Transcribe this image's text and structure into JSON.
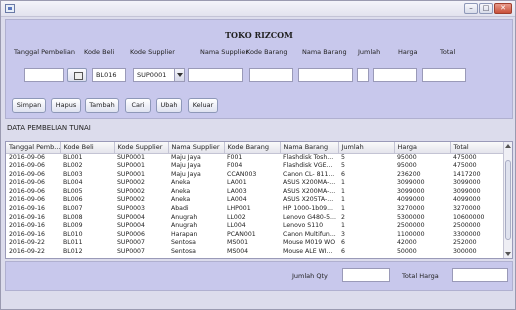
{
  "window": {
    "title": ""
  },
  "form": {
    "title": "TOKO RIZCOM",
    "labels": {
      "tanggal": "Tanggal Pembelian",
      "kode_beli": "Kode Beli",
      "kode_supplier": "Kode Supplier",
      "nama_supplier": "Nama Supplier",
      "kode_barang": "Kode Barang",
      "nama_barang": "Nama Barang",
      "jumlah": "Jumlah",
      "harga": "Harga",
      "total": "Total"
    },
    "values": {
      "tanggal": "",
      "kode_beli": "BL016",
      "kode_supplier": "SUP0001",
      "nama_supplier": "",
      "kode_barang": "",
      "nama_barang": "",
      "jumlah": "",
      "harga": "",
      "total": ""
    },
    "buttons": {
      "simpan": "Simpan",
      "hapus": "Hapus",
      "tambah": "Tambah",
      "cari": "Cari",
      "ubah": "Ubah",
      "keluar": "Keluar"
    }
  },
  "table": {
    "section_label": "DATA PEMBELIAN TUNAI",
    "columns": [
      "Tanggal Pemb...",
      "Kode Beli",
      "Kode Supplier",
      "Nama Supplier",
      "Kode Barang",
      "Nama Barang",
      "Jumlah",
      "Harga",
      "Total"
    ],
    "rows": [
      [
        "2016-09-06",
        "BL001",
        "SUP0001",
        "Maju Jaya",
        "F001",
        "Flashdisk Tosh...",
        "5",
        "95000",
        "475000"
      ],
      [
        "2016-09-06",
        "BL002",
        "SUP0001",
        "Maju Jaya",
        "F004",
        "Flashdisk VGE...",
        "5",
        "95000",
        "475000"
      ],
      [
        "2016-09-06",
        "BL003",
        "SUP0001",
        "Maju Jaya",
        "CCAN003",
        "Canon CL- 811...",
        "6",
        "236200",
        "1417200"
      ],
      [
        "2016-09-06",
        "BL004",
        "SUP0002",
        "Aneka",
        "LA001",
        "ASUS X200MA-...",
        "1",
        "3099000",
        "3099000"
      ],
      [
        "2016-09-06",
        "BL005",
        "SUP0002",
        "Aneka",
        "LA003",
        "ASUS X200MA-...",
        "1",
        "3099000",
        "3099000"
      ],
      [
        "2016-09-06",
        "BL006",
        "SUP0002",
        "Aneka",
        "LA004",
        "ASUS X205TA-...",
        "1",
        "4099000",
        "4099000"
      ],
      [
        "2016-09-16",
        "BL007",
        "SUP0003",
        "Abadi",
        "LHP001",
        "HP 1000-1b09...",
        "1",
        "3270000",
        "3270000"
      ],
      [
        "2016-09-16",
        "BL008",
        "SUP0004",
        "Anugrah",
        "LL002",
        "Lenovo G480-5...",
        "2",
        "5300000",
        "10600000"
      ],
      [
        "2016-09-16",
        "BL009",
        "SUP0004",
        "Anugrah",
        "LL004",
        "Lenovo S110",
        "1",
        "2500000",
        "2500000"
      ],
      [
        "2016-09-16",
        "BL010",
        "SUP0006",
        "Harapan",
        "PCAN001",
        "Canon Multifun...",
        "3",
        "1100000",
        "3300000"
      ],
      [
        "2016-09-22",
        "BL011",
        "SUP0007",
        "Sentosa",
        "MS001",
        "Mouse M019 WO",
        "6",
        "42000",
        "252000"
      ],
      [
        "2016-09-22",
        "BL012",
        "SUP0007",
        "Sentosa",
        "MS004",
        "Mouse ALE WI...",
        "6",
        "50000",
        "300000"
      ]
    ]
  },
  "footer": {
    "jumlah_qty_label": "Jumlah Qty",
    "total_harga_label": "Total Harga",
    "jumlah_qty_value": "",
    "total_harga_value": ""
  }
}
